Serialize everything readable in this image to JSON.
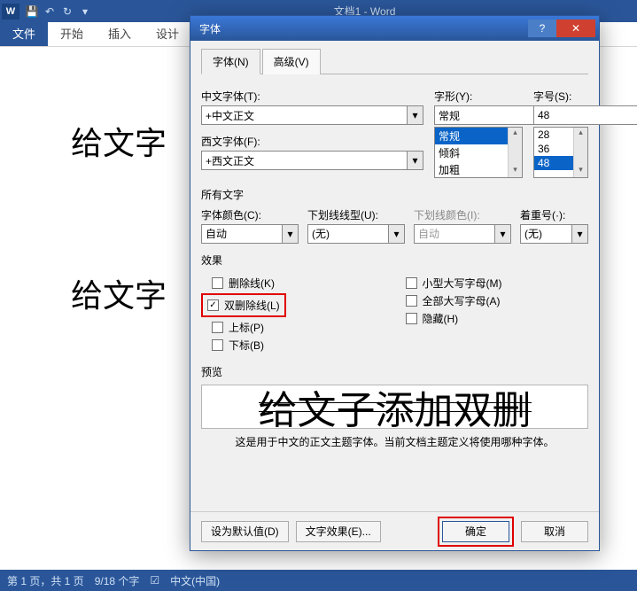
{
  "app": {
    "title": "文档1 - Word"
  },
  "qat": {
    "save": "💾",
    "undo": "↶",
    "redo": "↻"
  },
  "ribbon": {
    "file": "文件",
    "home": "开始",
    "insert": "插入",
    "design": "设计"
  },
  "doc": {
    "line1": "给文字",
    "line2": "给文字"
  },
  "status": {
    "page": "第 1 页，共 1 页",
    "words": "9/18 个字",
    "lang": "中文(中国)"
  },
  "dialog": {
    "title": "字体",
    "tabs": {
      "font": "字体(N)",
      "advanced": "高级(V)"
    },
    "cn_label": "中文字体(T):",
    "cn_value": "+中文正文",
    "en_label": "西文字体(F):",
    "en_value": "+西文正文",
    "style_label": "字形(Y):",
    "style_value": "常规",
    "style_list": [
      "常规",
      "倾斜",
      "加粗"
    ],
    "size_label": "字号(S):",
    "size_value": "48",
    "size_list": [
      "28",
      "36",
      "48"
    ],
    "all_text": "所有文字",
    "color_label": "字体颜色(C):",
    "color_value": "自动",
    "underline_label": "下划线线型(U):",
    "underline_value": "(无)",
    "ucolor_label": "下划线颜色(I):",
    "ucolor_value": "自动",
    "emphasis_label": "着重号(·):",
    "emphasis_value": "(无)",
    "effects": "效果",
    "chk": {
      "strike": "删除线(K)",
      "dstrike": "双删除线(L)",
      "super": "上标(P)",
      "sub": "下标(B)",
      "smallcaps": "小型大写字母(M)",
      "allcaps": "全部大写字母(A)",
      "hidden": "隐藏(H)"
    },
    "preview": "预览",
    "preview_text": "给文子添加双删",
    "preview_desc": "这是用于中文的正文主题字体。当前文档主题定义将使用哪种字体。",
    "footer": {
      "default": "设为默认值(D)",
      "texteff": "文字效果(E)...",
      "ok": "确定",
      "cancel": "取消"
    }
  }
}
